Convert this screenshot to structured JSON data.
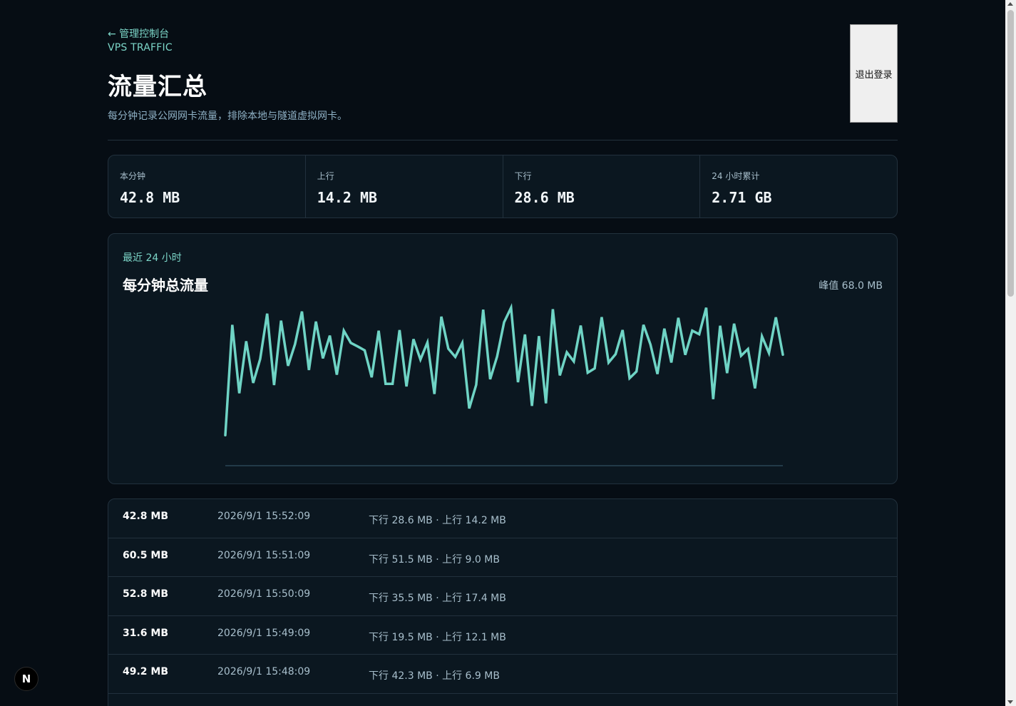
{
  "header": {
    "back_link": "← 管理控制台",
    "eyebrow": "VPS TRAFFIC",
    "title": "流量汇总",
    "subtitle": "每分钟记录公网网卡流量，排除本地与隧道虚拟网卡。",
    "logout_label": "退出登录"
  },
  "stats": [
    {
      "label": "本分钟",
      "value": "42.8 MB"
    },
    {
      "label": "上行",
      "value": "14.2 MB"
    },
    {
      "label": "下行",
      "value": "28.6 MB"
    },
    {
      "label": "24 小时累计",
      "value": "2.71 GB"
    }
  ],
  "chart": {
    "eyebrow": "最近 24 小时",
    "title": "每分钟总流量",
    "peak": "峰值 68.0 MB",
    "line_color": "#6fd4c5"
  },
  "chart_data": {
    "type": "line",
    "title": "每分钟总流量",
    "xlabel": "",
    "ylabel": "",
    "unit": "MB",
    "ylim": [
      0,
      70
    ],
    "grid": false,
    "legend": "none",
    "series": [
      {
        "values": [
          13.0,
          60.1,
          30.9,
          53.1,
          35.3,
          45.5,
          64.9,
          34.4,
          61.9,
          42.6,
          51.9,
          65.8,
          40.8,
          61.5,
          45.8,
          55.5,
          38.8,
          57.6,
          52.4,
          50.9,
          49.2,
          37.7,
          57.6,
          34.9,
          34.9,
          57.9,
          33.8,
          54.0,
          45.3,
          52.6,
          30.6,
          63.6,
          49.9,
          46.4,
          52.4,
          24.4,
          34.5,
          66.6,
          36.9,
          46.6,
          61.2,
          67.4,
          35.6,
          56.0,
          25.5,
          55.3,
          26.6,
          66.8,
          38.5,
          48.4,
          44.5,
          59.8,
          39.7,
          41.5,
          63.4,
          44.0,
          47.6,
          57.9,
          37.3,
          40.2,
          60.1,
          51.7,
          39.1,
          58.5,
          44.0,
          63.1,
          47.3,
          57.6,
          56.1,
          67.4,
          28.4,
          59.7,
          39.5,
          60.6,
          46.9,
          49.8,
          33.0,
          55.2,
          48.1,
          63.3,
          47.4
        ]
      }
    ]
  },
  "records": [
    {
      "total": "42.8 MB",
      "time": "2026/9/1 15:52:09",
      "detail": "下行 28.6 MB · 上行 14.2 MB"
    },
    {
      "total": "60.5 MB",
      "time": "2026/9/1 15:51:09",
      "detail": "下行 51.5 MB · 上行 9.0 MB"
    },
    {
      "total": "52.8 MB",
      "time": "2026/9/1 15:50:09",
      "detail": "下行 35.5 MB · 上行 17.4 MB"
    },
    {
      "total": "31.6 MB",
      "time": "2026/9/1 15:49:09",
      "detail": "下行 19.5 MB · 上行 12.1 MB"
    },
    {
      "total": "49.2 MB",
      "time": "2026/9/1 15:48:09",
      "detail": "下行 42.3 MB · 上行 6.9 MB"
    },
    {
      "total": "",
      "time": "",
      "detail": ""
    }
  ],
  "dev_badge": {
    "label": "N"
  }
}
